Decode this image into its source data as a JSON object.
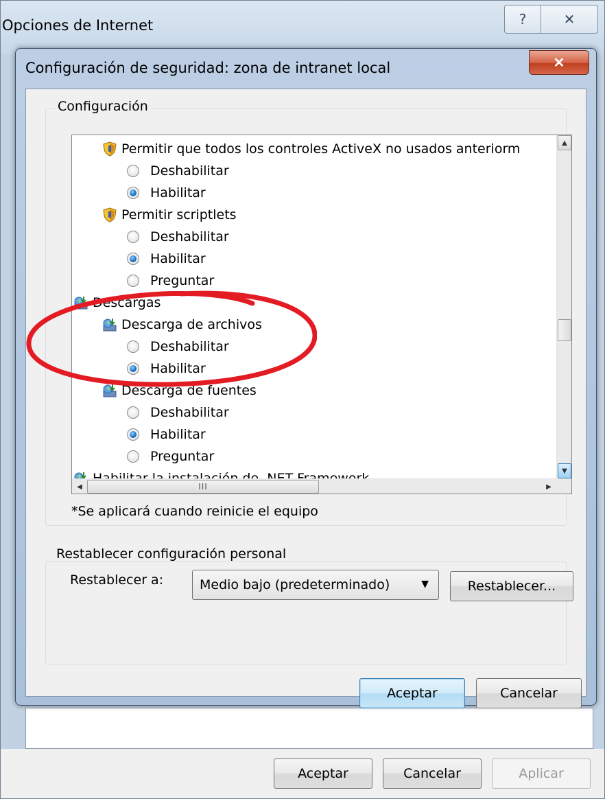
{
  "outer_window": {
    "title": "Opciones de Internet",
    "help_glyph": "?",
    "close_glyph": "✕",
    "buttons": {
      "accept": "Aceptar",
      "cancel": "Cancelar",
      "apply": "Aplicar"
    }
  },
  "dialog": {
    "title": "Configuración de seguridad: zona de intranet local",
    "close_glyph": "✕",
    "config_group_label": "Configuración",
    "settings_tree": [
      {
        "kind": "setting",
        "icon": "shield-icon",
        "label": "Permitir que todos los controles ActiveX no usados anteriorm"
      },
      {
        "kind": "option",
        "label": "Deshabilitar",
        "checked": false
      },
      {
        "kind": "option",
        "label": "Habilitar",
        "checked": true
      },
      {
        "kind": "setting",
        "icon": "shield-icon",
        "label": "Permitir scriptlets"
      },
      {
        "kind": "option",
        "label": "Deshabilitar",
        "checked": false
      },
      {
        "kind": "option",
        "label": "Habilitar",
        "checked": true
      },
      {
        "kind": "option",
        "label": "Preguntar",
        "checked": false
      },
      {
        "kind": "category",
        "icon": "download-icon",
        "label": "Descargas"
      },
      {
        "kind": "setting",
        "icon": "download-icon",
        "label": "Descarga de archivos"
      },
      {
        "kind": "option",
        "label": "Deshabilitar",
        "checked": false
      },
      {
        "kind": "option",
        "label": "Habilitar",
        "checked": true
      },
      {
        "kind": "setting",
        "icon": "download-icon",
        "label": "Descarga de fuentes"
      },
      {
        "kind": "option",
        "label": "Deshabilitar",
        "checked": false
      },
      {
        "kind": "option",
        "label": "Habilitar",
        "checked": true
      },
      {
        "kind": "option",
        "label": "Preguntar",
        "checked": false
      },
      {
        "kind": "category",
        "icon": "download-icon",
        "label": "Habilitar la instalación de .NET Framework"
      }
    ],
    "hscroll_thumb_glyph": "III",
    "restart_note": "*Se aplicará cuando reinicie el equipo",
    "reset_group_label": "Restablecer configuración personal",
    "reset_to_label": "Restablecer a:",
    "reset_level_value": "Medio bajo (predeterminado)",
    "reset_button": "Restablecer...",
    "accept": "Aceptar",
    "cancel": "Cancelar"
  },
  "annotation": {
    "color": "#e31b23"
  }
}
